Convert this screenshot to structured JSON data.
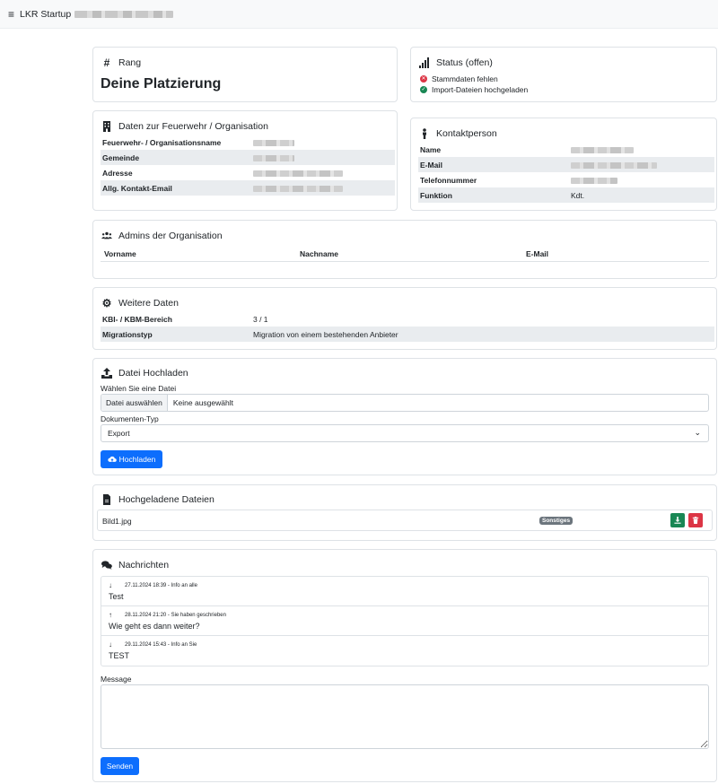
{
  "header": {
    "title": "LKR Startup"
  },
  "rang": {
    "title": "Rang",
    "heading": "Deine Platzierung"
  },
  "status": {
    "title": "Status (offen)",
    "items": [
      {
        "label": "Stammdaten fehlen",
        "state": "error",
        "color": "#dc3545"
      },
      {
        "label": "Import-Dateien hochgeladen",
        "state": "ok",
        "color": "#198754"
      }
    ]
  },
  "org": {
    "title": "Daten zur Feuerwehr / Organisation",
    "rows": [
      {
        "label": "Feuerwehr- / Organisationsname"
      },
      {
        "label": "Gemeinde"
      },
      {
        "label": "Adresse"
      },
      {
        "label": "Allg. Kontakt-Email"
      }
    ]
  },
  "contact": {
    "title": "Kontaktperson",
    "rows": [
      {
        "label": "Name",
        "value": ""
      },
      {
        "label": "E-Mail",
        "value": ""
      },
      {
        "label": "Telefonnummer",
        "value": ""
      },
      {
        "label": "Funktion",
        "value": "Kdt."
      }
    ]
  },
  "admins": {
    "title": "Admins der Organisation",
    "columns": [
      "Vorname",
      "Nachname",
      "E-Mail"
    ]
  },
  "more": {
    "title": "Weitere Daten",
    "rows": [
      {
        "label": "KBI- / KBM-Bereich",
        "value": "3 / 1"
      },
      {
        "label": "Migrationstyp",
        "value": "Migration von einem bestehenden Anbieter"
      }
    ]
  },
  "upload": {
    "title": "Datei Hochladen",
    "file_label": "Wählen Sie eine Datei",
    "file_button": "Datei auswählen",
    "file_none": "Keine ausgewählt",
    "type_label": "Dokumenten-Typ",
    "type_value": "Export",
    "submit": "Hochladen"
  },
  "files": {
    "title": "Hochgeladene Dateien",
    "items": [
      {
        "name": "Bild1.jpg",
        "badge": "Sonstiges"
      }
    ]
  },
  "messages": {
    "title": "Nachrichten",
    "items": [
      {
        "direction": "in",
        "meta": "27.11.2024 18:39 - Info an alle",
        "text": "Test"
      },
      {
        "direction": "out",
        "meta": "28.11.2024 21:20 - Sie haben geschrieben",
        "text": "Wie geht es dann weiter?"
      },
      {
        "direction": "in",
        "meta": "29.11.2024 15:43 - Info an Sie",
        "text": "TEST"
      }
    ],
    "compose_label": "Message",
    "send": "Senden"
  },
  "colors": {
    "primary": "#0d6efd",
    "success": "#198754",
    "danger": "#dc3545",
    "badge": "#6c757d"
  }
}
